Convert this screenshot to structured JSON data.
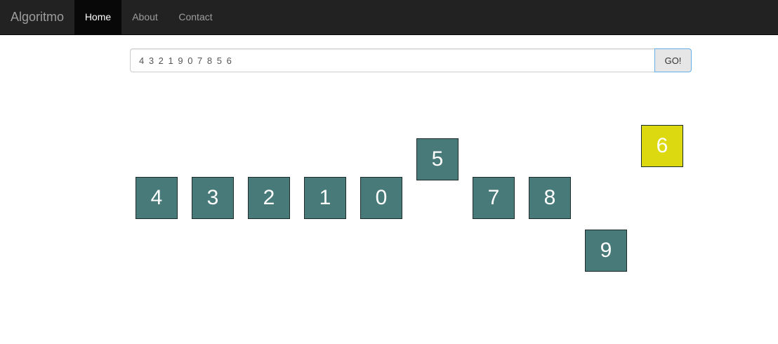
{
  "navbar": {
    "brand": "Algoritmo",
    "items": [
      {
        "label": "Home",
        "active": true
      },
      {
        "label": "About",
        "active": false
      },
      {
        "label": "Contact",
        "active": false
      }
    ]
  },
  "form": {
    "input_value": "4 3 2 1 9 0 7 8 5 6",
    "button_label": "GO!"
  },
  "colors": {
    "tile": "#487a7a",
    "tile_highlight": "#dcd911"
  },
  "tiles": [
    {
      "value": "4",
      "level": "middle",
      "highlighted": false
    },
    {
      "value": "3",
      "level": "middle",
      "highlighted": false
    },
    {
      "value": "2",
      "level": "middle",
      "highlighted": false
    },
    {
      "value": "1",
      "level": "middle",
      "highlighted": false
    },
    {
      "value": "0",
      "level": "middle",
      "highlighted": false
    },
    {
      "value": "5",
      "level": "raised",
      "highlighted": false
    },
    {
      "value": "7",
      "level": "middle",
      "highlighted": false
    },
    {
      "value": "8",
      "level": "middle",
      "highlighted": false
    },
    {
      "value": "9",
      "level": "lowered",
      "highlighted": false
    },
    {
      "value": "6",
      "level": "top",
      "highlighted": true
    }
  ]
}
